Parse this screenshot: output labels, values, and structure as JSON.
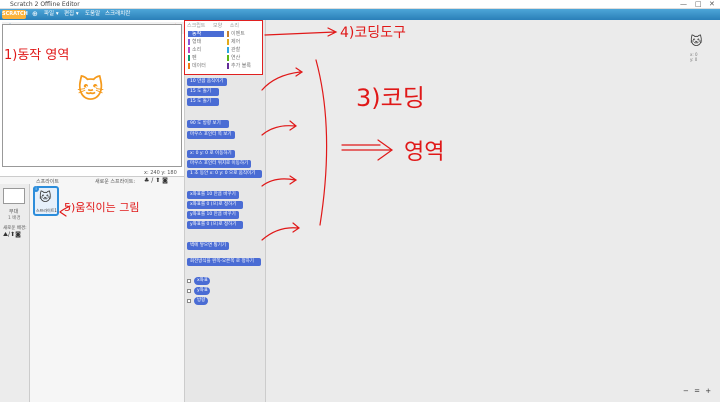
{
  "window": {
    "title": "Scratch 2 Offline Editor",
    "controls": [
      "—",
      "□",
      "✕"
    ]
  },
  "menu": {
    "logo": "SCRATCH",
    "items": [
      "파일 ▾",
      "편집 ▾",
      "도움말",
      "스크래치란"
    ]
  },
  "toolbar_icons": [
    "person-icon",
    "stamp-icon",
    "expand-icon",
    "shrink-icon",
    "help-icon"
  ],
  "stage": {
    "flag": "▶",
    "stop": "●",
    "coords": "x: 240  y: 180"
  },
  "sprite_panel": {
    "header": "스프라이트",
    "new_sprite_label": "새로운 스프라이트:",
    "stage_label": "무대",
    "stage_count": "1 배경",
    "new_backdrop": "새로운 배경:",
    "sprite_name": "스프라이트1",
    "sprite_badge": "i"
  },
  "palette": {
    "tabs": [
      "스크립트",
      "모양",
      "소리"
    ],
    "categories_left": [
      {
        "label": "동작",
        "color": "#4a6cd4"
      },
      {
        "label": "형태",
        "color": "#8a55d7"
      },
      {
        "label": "소리",
        "color": "#bb42c3"
      },
      {
        "label": "펜",
        "color": "#0e9a6c"
      },
      {
        "label": "데이터",
        "color": "#ee7d16"
      }
    ],
    "categories_right": [
      {
        "label": "이벤트",
        "color": "#c88330"
      },
      {
        "label": "제어",
        "color": "#e1a91a"
      },
      {
        "label": "관찰",
        "color": "#2ca5e2"
      },
      {
        "label": "연산",
        "color": "#5cb712"
      },
      {
        "label": "추가 블록",
        "color": "#632d99"
      }
    ]
  },
  "blocks": [
    "10 만큼 움직이기",
    "15 도 돌기",
    "15 도 돌기",
    "90 도 방향 보기",
    "마우스 포인터 쪽 보기",
    "x: 0 y: 0 로 이동하기",
    "마우스 포인터 위치로 이동하기",
    "1 초 동안 x: 0 y: 0 으로 움직이기",
    "x좌표를 10 만큼 바꾸기",
    "x좌표를 0 (으)로 정하기",
    "y좌표를 10 만큼 바꾸기",
    "y좌표를 0 (으)로 정하기",
    "벽에 닿으면 튕기기",
    "회전방식을 왼쪽-오른쪽 로 정하기",
    "x좌표",
    "y좌표",
    "방향"
  ],
  "annotations": {
    "stage_area": "1)동작 영역",
    "sprite": "5)움직이는 그림",
    "coding_tools": "4)코딩도구",
    "coding": "3)코딩",
    "area": "영역"
  },
  "zoom_controls": [
    "−",
    "=",
    "+"
  ]
}
